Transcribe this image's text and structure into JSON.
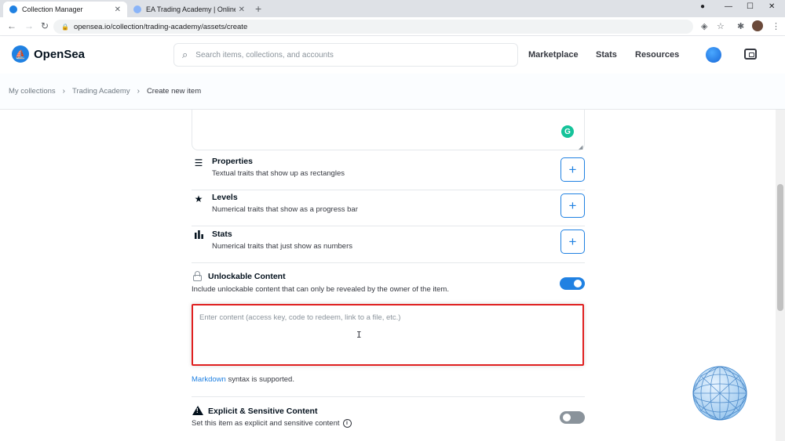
{
  "browser": {
    "tabs": [
      {
        "title": "Collection Manager",
        "color": "#2081e2"
      },
      {
        "title": "EA Trading Academy | Online Co",
        "color": "#8ab4f8"
      }
    ],
    "url": "opensea.io/collection/trading-academy/assets/create"
  },
  "header": {
    "brand": "OpenSea",
    "search_placeholder": "Search items, collections, and accounts",
    "nav": [
      "Marketplace",
      "Stats",
      "Resources"
    ]
  },
  "breadcrumb": [
    "My collections",
    "Trading Academy",
    "Create new item"
  ],
  "traits": [
    {
      "title": "Properties",
      "desc": "Textual traits that show up as rectangles",
      "icon": "list-icon"
    },
    {
      "title": "Levels",
      "desc": "Numerical traits that show as a progress bar",
      "icon": "star-icon"
    },
    {
      "title": "Stats",
      "desc": "Numerical traits that just show as numbers",
      "icon": "bar-chart-icon"
    }
  ],
  "unlockable": {
    "title": "Unlockable Content",
    "desc": "Include unlockable content that can only be revealed by the owner of the item.",
    "enabled": true,
    "placeholder": "Enter content (access key, code to redeem, link to a file, etc.)",
    "value": ""
  },
  "markdown_note": {
    "link": "Markdown",
    "rest": " syntax is supported."
  },
  "explicit": {
    "title": "Explicit & Sensitive Content",
    "desc": "Set this item as explicit and sensitive content",
    "enabled": false
  },
  "colors": {
    "accent": "#2081e2",
    "highlight": "#e02020",
    "grammarly": "#15c39a"
  }
}
